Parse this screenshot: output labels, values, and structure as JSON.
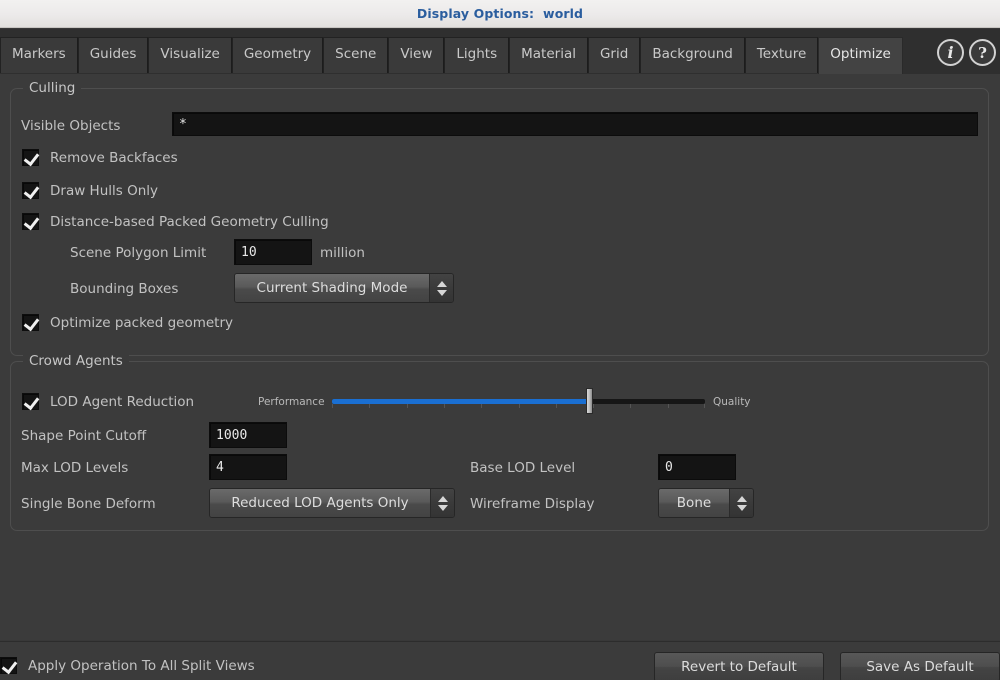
{
  "window": {
    "title_prefix": "Display Options:",
    "title_value": "world",
    "title_full": "Display Options:  world"
  },
  "tabs": [
    {
      "label": "Markers",
      "active": false
    },
    {
      "label": "Guides",
      "active": false
    },
    {
      "label": "Visualize",
      "active": false
    },
    {
      "label": "Geometry",
      "active": false
    },
    {
      "label": "Scene",
      "active": false
    },
    {
      "label": "View",
      "active": false
    },
    {
      "label": "Lights",
      "active": false
    },
    {
      "label": "Material",
      "active": false
    },
    {
      "label": "Grid",
      "active": false
    },
    {
      "label": "Background",
      "active": false
    },
    {
      "label": "Texture",
      "active": false
    },
    {
      "label": "Optimize",
      "active": true
    }
  ],
  "header_icons": {
    "info": "i",
    "help": "?"
  },
  "culling": {
    "legend": "Culling",
    "visible_objects": {
      "label": "Visible Objects",
      "value": "*",
      "placeholder": "*"
    },
    "remove_backfaces": {
      "label": "Remove Backfaces",
      "checked": true
    },
    "draw_hulls_only": {
      "label": "Draw Hulls Only",
      "checked": true
    },
    "distance_culling": {
      "label": "Distance-based Packed Geometry Culling",
      "checked": true
    },
    "scene_polygon_limit": {
      "label": "Scene Polygon Limit",
      "value": "10",
      "suffix": "million"
    },
    "bounding_boxes": {
      "label": "Bounding Boxes",
      "value": "Current Shading Mode"
    },
    "optimize_packed_geometry": {
      "label": "Optimize packed geometry",
      "checked": true
    }
  },
  "crowd_agents": {
    "legend": "Crowd Agents",
    "lod_agent_reduction": {
      "label": "LOD Agent Reduction",
      "checked": true,
      "slider": {
        "left_label": "Performance",
        "right_label": "Quality",
        "value_percent": 69,
        "fill_color": "#1a6fd2"
      }
    },
    "shape_point_cutoff": {
      "label": "Shape Point Cutoff",
      "value": "1000"
    },
    "max_lod_levels": {
      "label": "Max LOD Levels",
      "value": "4"
    },
    "base_lod_level": {
      "label": "Base LOD Level",
      "value": "0"
    },
    "single_bone_deform": {
      "label": "Single Bone Deform",
      "value": "Reduced LOD Agents Only"
    },
    "wireframe_display": {
      "label": "Wireframe Display",
      "value": "Bone"
    }
  },
  "footer": {
    "apply_all_split_views": {
      "label": "Apply Operation To All Split Views",
      "checked": true
    },
    "revert_button": "Revert to Default",
    "save_button": "Save As Default"
  }
}
